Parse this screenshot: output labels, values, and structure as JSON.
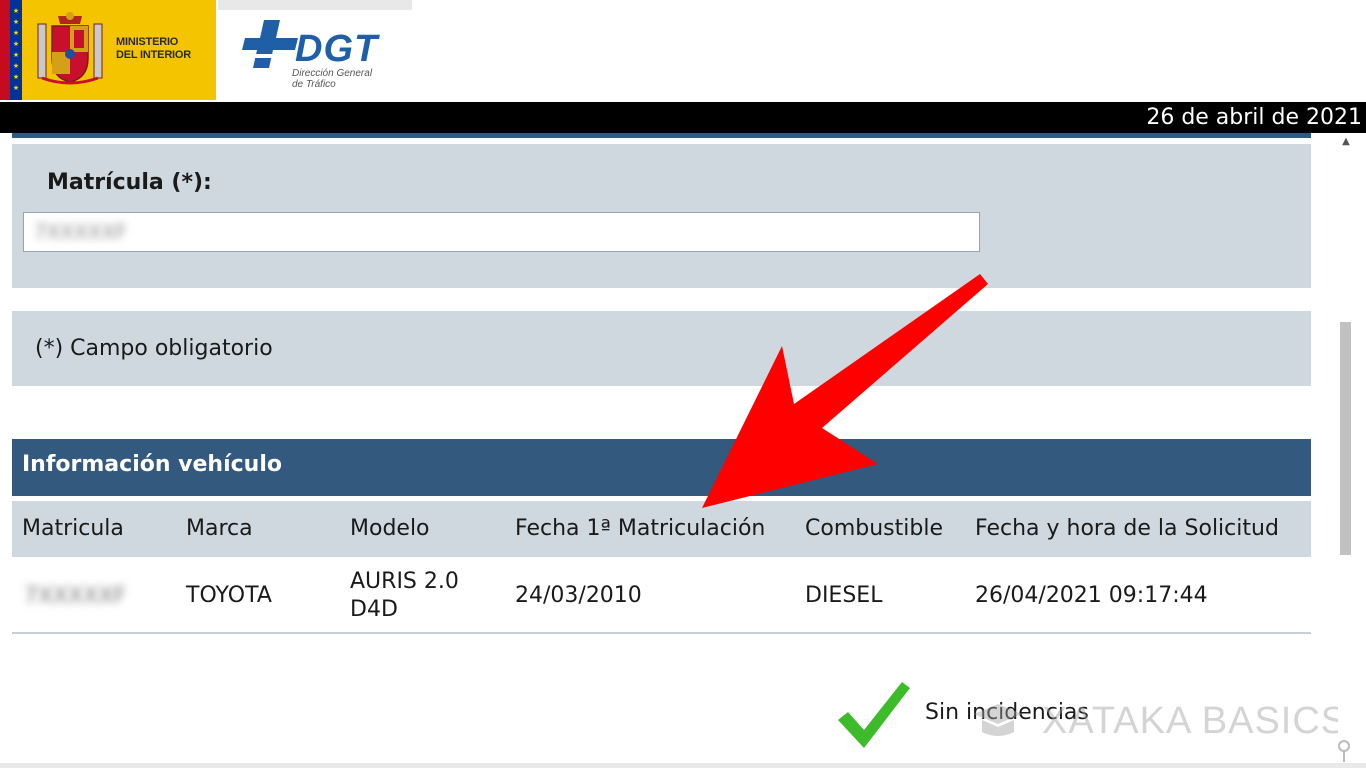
{
  "header": {
    "ministry_line1": "MINISTERIO",
    "ministry_line2": "DEL INTERIOR",
    "dgt_word": "DGT",
    "dgt_sub_line1": "Dirección General",
    "dgt_sub_line2": "de Tráfico",
    "date": "26 de abril de 2021"
  },
  "form": {
    "matricula_label": "Matrícula (*):",
    "matricula_value_blurred": "7XXXXXF",
    "required_note": "(*) Campo obligatorio"
  },
  "vehicle_info": {
    "title": "Información vehículo",
    "columns": [
      "Matricula",
      "Marca",
      "Modelo",
      "Fecha 1ª Matriculación",
      "Combustible",
      "Fecha y hora de la Solicitud"
    ],
    "row": {
      "matricula_blurred": "7XXXXXF",
      "marca": "TOYOTA",
      "modelo_line1": "AURIS 2.0",
      "modelo_line2": "D4D",
      "fecha_matriculacion": "24/03/2010",
      "combustible": "DIESEL",
      "fecha_solicitud": "26/04/2021 09:17:44"
    }
  },
  "status": {
    "text": "Sin incidencias"
  },
  "watermark": {
    "text": "XATAKA BASICS"
  },
  "colors": {
    "header_blue": "#33597f",
    "panel_gray": "#cfd8df",
    "arrow_red": "#ff0000",
    "check_green": "#3dbb2a",
    "ministry_yellow": "#f5c400",
    "dgt_blue": "#1f5fa8"
  }
}
